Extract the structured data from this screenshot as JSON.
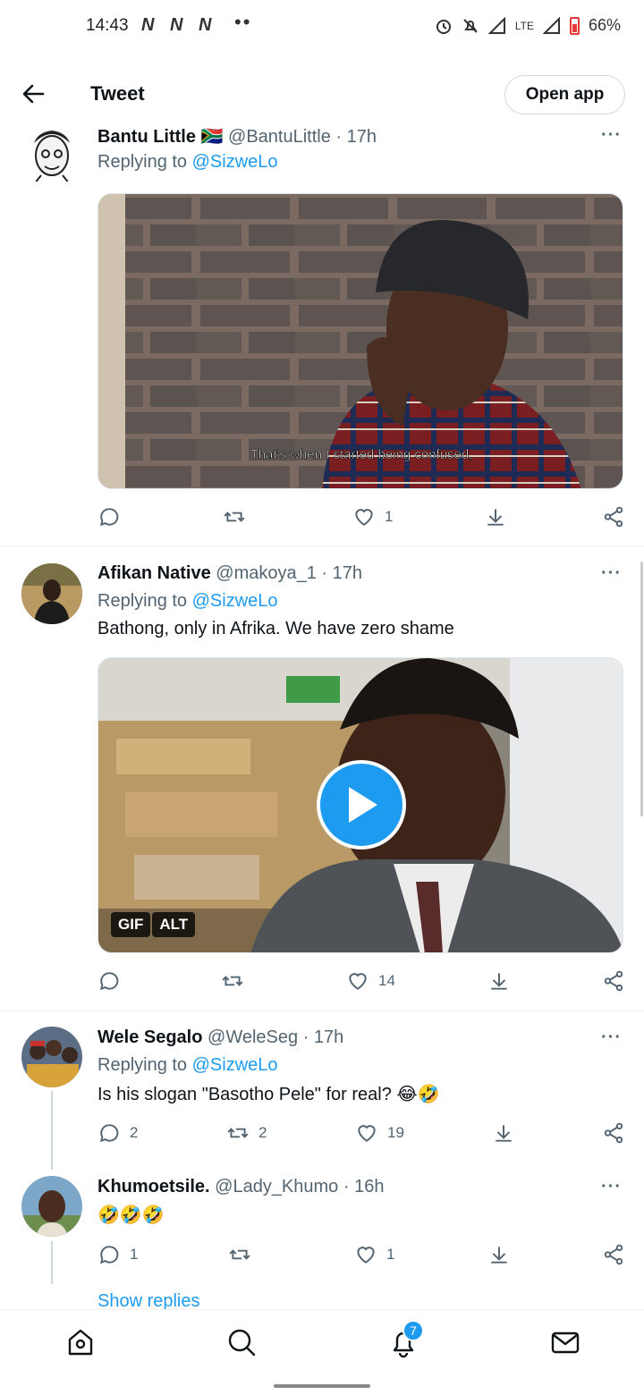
{
  "status_bar": {
    "time": "14:43",
    "notif_icons": "N N N",
    "network": "LTE",
    "battery": "66%"
  },
  "header": {
    "title": "Tweet",
    "open_app": "Open app"
  },
  "tweets": [
    {
      "name": "Bantu Little",
      "flag": "🇿🇦",
      "handle": "@BantuLittle",
      "time": "· 17h",
      "replying_prefix": "Replying to ",
      "replying_to": "@SizweLo",
      "text": "",
      "media_caption": "That's when I started being confused,",
      "likes": "1"
    },
    {
      "name": "Afikan Native",
      "handle": "@makoya_1",
      "time": "· 17h",
      "replying_prefix": "Replying to ",
      "replying_to": "@SizweLo",
      "text": "Bathong, only in Afrika. We have zero shame",
      "gif_label": "GIF",
      "alt_label": "ALT",
      "likes": "14"
    },
    {
      "name": "Wele Segalo",
      "handle": "@WeleSeg",
      "time": "· 17h",
      "replying_prefix": "Replying to ",
      "replying_to": "@SizweLo",
      "text": "Is his slogan \"Basotho Pele\" for real? 😂🤣",
      "replies": "2",
      "retweets": "2",
      "likes": "19"
    },
    {
      "name": "Khumoetsile.",
      "handle": "@Lady_Khumo",
      "time": "· 16h",
      "text": "🤣🤣🤣",
      "replies": "1",
      "likes": "1"
    }
  ],
  "show_replies": "Show replies",
  "more_label": "···",
  "notification_badge": "7",
  "colors": {
    "accent": "#1d9bf0",
    "text": "#0f1419",
    "secondary": "#536471"
  }
}
